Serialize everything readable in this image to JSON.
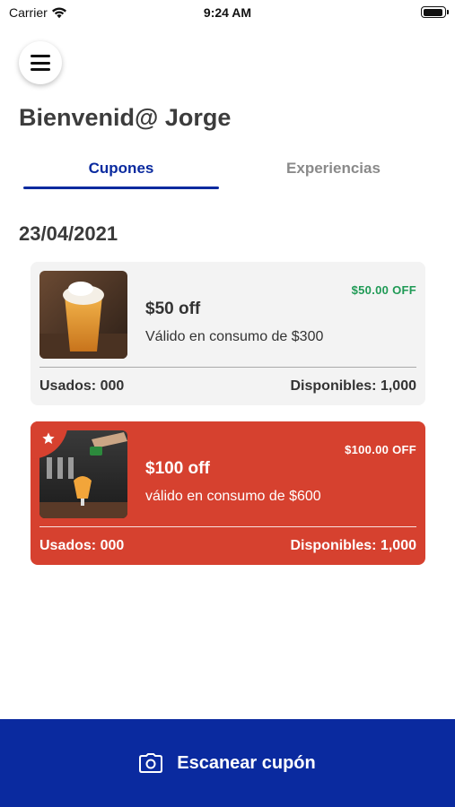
{
  "status_bar": {
    "carrier": "Carrier",
    "time": "9:24 AM"
  },
  "header": {
    "menu_icon": "hamburger-icon",
    "welcome": "Bienvenid@ Jorge"
  },
  "tabs": [
    {
      "label": "Cupones",
      "active": true
    },
    {
      "label": "Experiencias",
      "active": false
    }
  ],
  "date": "23/04/2021",
  "coupons": [
    {
      "title": "$50 off",
      "subtitle": "Válido en consumo de $300",
      "amount": "$50.00 OFF",
      "used": "Usados: 000",
      "available": "Disponibles: 1,000",
      "image": "beer-glass-photo",
      "featured": false,
      "background": "#f3f3f3",
      "amount_color": "#1f9a55"
    },
    {
      "title": "$100 off",
      "subtitle": "válido en consumo de $600",
      "amount": "$100.00 OFF",
      "used": "Usados: 000",
      "available": "Disponibles: 1,000",
      "image": "beer-tap-pour-photo",
      "featured": true,
      "background": "#d6412f",
      "amount_color": "#ffffff"
    }
  ],
  "scan_button": {
    "label": "Escanear cupón",
    "icon": "camera-icon"
  },
  "colors": {
    "primary": "#0a2a9f",
    "featured_card": "#d6412f",
    "discount_green": "#1f9a55"
  }
}
